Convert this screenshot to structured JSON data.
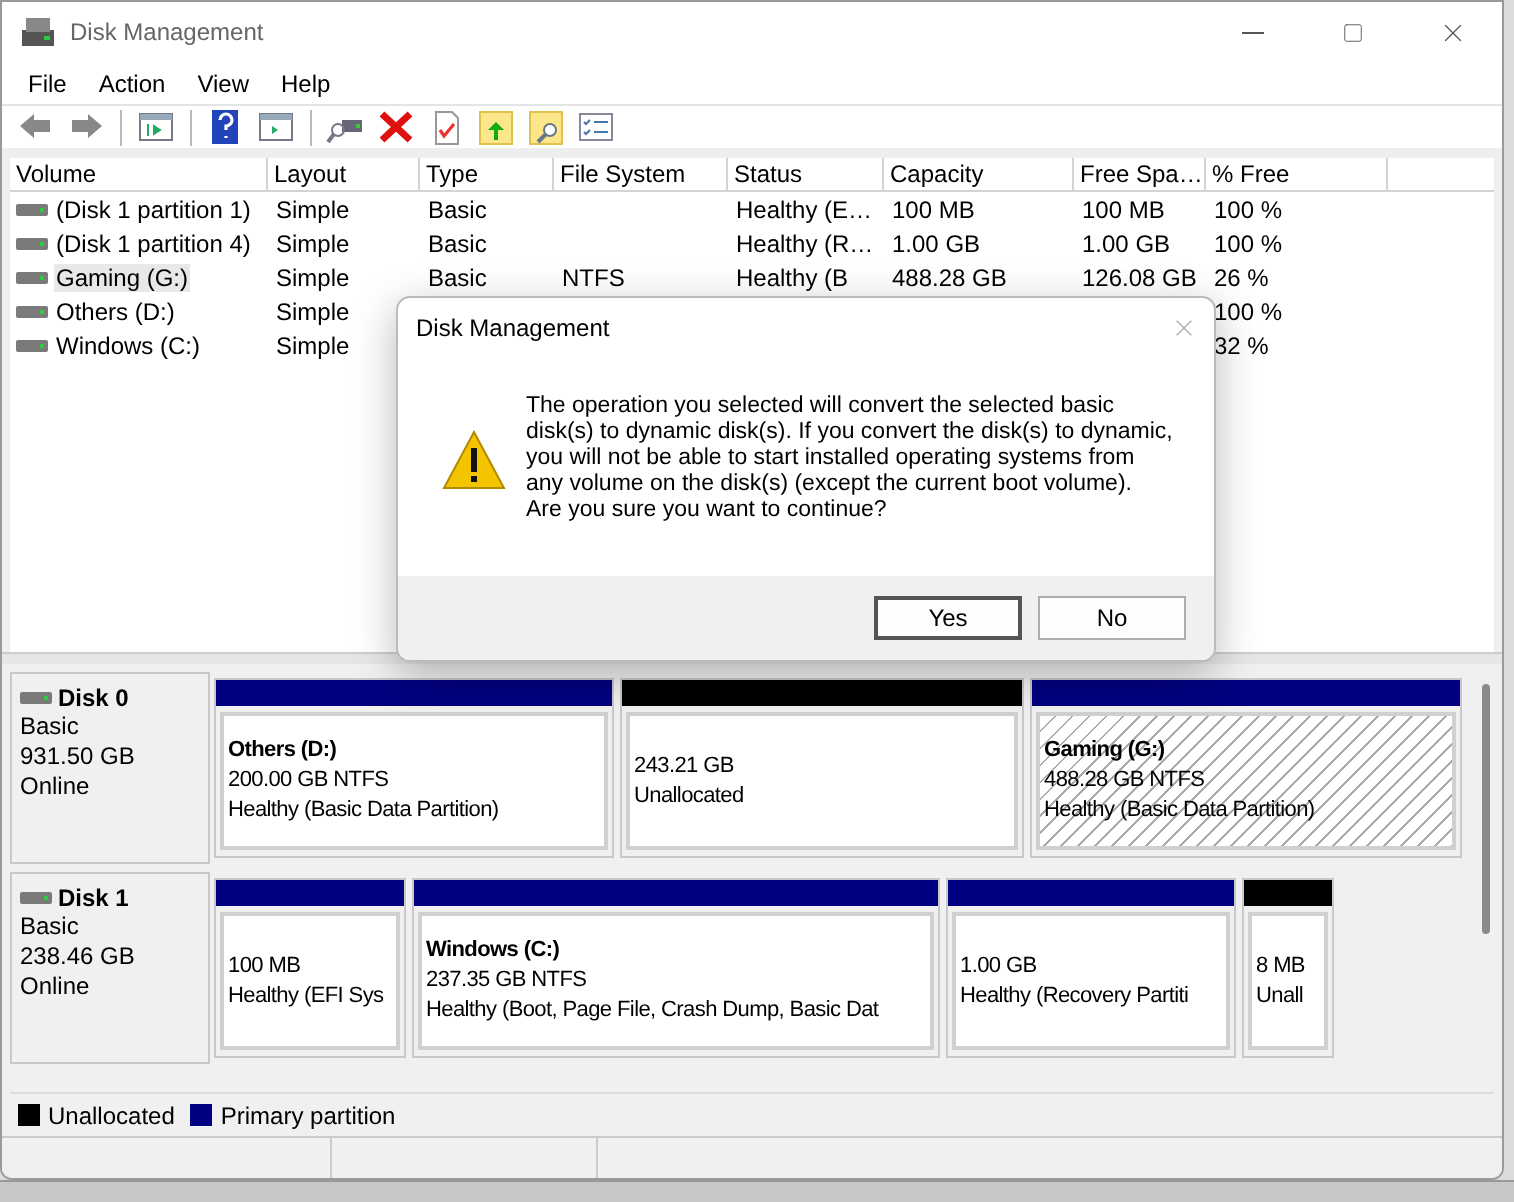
{
  "window": {
    "title": "Disk Management"
  },
  "menu": [
    "File",
    "Action",
    "View",
    "Help"
  ],
  "volumes": {
    "columns": [
      "Volume",
      "Layout",
      "Type",
      "File System",
      "Status",
      "Capacity",
      "Free Spa…",
      "% Free"
    ],
    "rows": [
      {
        "selected": false,
        "cells": [
          "(Disk 1 partition 1)",
          "Simple",
          "Basic",
          null,
          "Healthy (E…",
          "100 MB",
          "100 MB",
          "100 %"
        ]
      },
      {
        "selected": false,
        "cells": [
          "(Disk 1 partition 4)",
          "Simple",
          "Basic",
          null,
          "Healthy (R…",
          "1.00 GB",
          "1.00 GB",
          "100 %"
        ]
      },
      {
        "selected": true,
        "cells": [
          "Gaming (G:)",
          "Simple",
          "Basic",
          "NTFS",
          "Healthy (B",
          "488.28 GB",
          "126.08 GB",
          "26 %"
        ]
      },
      {
        "selected": false,
        "cells": [
          "Others (D:)",
          "Simple",
          null,
          null,
          null,
          null,
          null,
          "100 %"
        ]
      },
      {
        "selected": false,
        "cells": [
          "Windows (C:)",
          "Simple",
          null,
          null,
          null,
          null,
          null,
          "32 %"
        ]
      }
    ]
  },
  "disks": [
    {
      "name": "Disk 0",
      "type": "Basic",
      "size": "931.50 GB",
      "status": "Online",
      "partitions": [
        {
          "kind": "primary",
          "name": "Others  (D:)",
          "size": "200.00 GB NTFS",
          "status": "Healthy (Basic Data Partition)",
          "selected": false
        },
        {
          "kind": "unallocated",
          "size": "243.21 GB",
          "status": "Unallocated",
          "selected": false
        },
        {
          "kind": "primary",
          "name": "Gaming  (G:)",
          "size": "488.28 GB NTFS",
          "status": "Healthy (Basic Data Partition)",
          "selected": true
        }
      ]
    },
    {
      "name": "Disk 1",
      "type": "Basic",
      "size": "238.46 GB",
      "status": "Online",
      "partitions": [
        {
          "kind": "primary",
          "size": "100 MB",
          "status": "Healthy (EFI Sys",
          "selected": false
        },
        {
          "kind": "primary",
          "name": "Windows  (C:)",
          "size": "237.35 GB NTFS",
          "status": "Healthy (Boot, Page File, Crash Dump, Basic Dat",
          "selected": false
        },
        {
          "kind": "primary",
          "size": "1.00 GB",
          "status": "Healthy (Recovery Partiti",
          "selected": false
        },
        {
          "kind": "unallocated",
          "size": "8 MB",
          "status": "Unall",
          "selected": false
        }
      ]
    }
  ],
  "legend": [
    {
      "label": "Unallocated",
      "color": "#000000"
    },
    {
      "label": "Primary partition",
      "color": "#000080"
    }
  ],
  "dialog": {
    "title": "Disk Management",
    "message": "The operation you selected will convert the selected basic\ndisk(s) to dynamic disk(s). If you convert the disk(s) to dynamic,\nyou will not be able to start installed operating systems from\nany volume on the disk(s) (except the current boot volume).\nAre you sure you want to continue?",
    "buttons": [
      {
        "label": "Yes",
        "default": true
      },
      {
        "label": "No",
        "default": false
      }
    ]
  }
}
